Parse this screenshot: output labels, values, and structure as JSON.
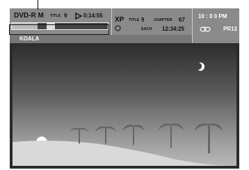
{
  "disc_type": "DVD-R M",
  "title_label": "TITLE",
  "title_number": "9",
  "play_icon": "play-triangle-icon",
  "elapsed_time": "0:14:55",
  "progress_fraction": 0.27,
  "progress_marker_fraction": 0.36,
  "program_name": "KOALA",
  "record_mode": "XP",
  "record_icon": "disc-icon",
  "chapter_title_number": "9",
  "chapter_label": "CHAPTER",
  "chapter_number": "67",
  "each_label": "EACH",
  "chapter_time": "12:34:25",
  "clock_time": "10 : 0 0 PM",
  "audio_icon": "stereo-oval-icon",
  "preset_channel": "PR12"
}
